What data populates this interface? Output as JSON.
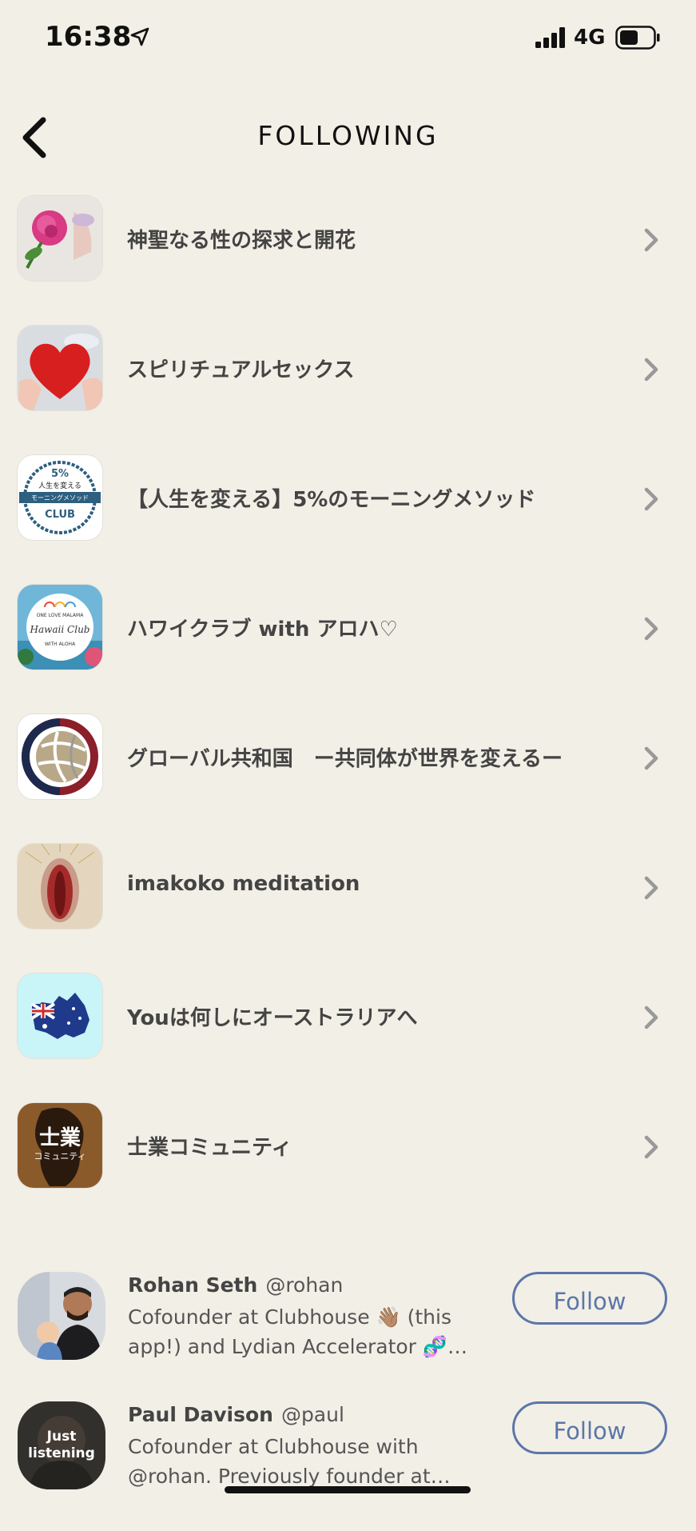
{
  "status_bar": {
    "time": "16:38",
    "network": "4G"
  },
  "header": {
    "title": "FOLLOWING"
  },
  "clubs": [
    {
      "name": "神聖なる性の探求と開花",
      "icon": "rose-image"
    },
    {
      "name": "スピリチュアルセックス",
      "icon": "heart-image"
    },
    {
      "name": "【人生を変える】5%のモーニングメソッド",
      "icon": "club-badge-image",
      "badge_top": "5%",
      "badge_mid": "人生を変える",
      "badge_band": "モーニングメソッド",
      "badge_bottom": "CLUB"
    },
    {
      "name": "ハワイクラブ with アロハ♡",
      "icon": "hawaii-club-image",
      "badge_top": "ONE LOVE MALAMA",
      "badge_mid": "Hawaii Club",
      "badge_bottom": "WITH ALOHA"
    },
    {
      "name": "グローバル共和国　ー共同体が世界を変えるー",
      "icon": "globe-logo"
    },
    {
      "name": "imakoko meditation",
      "icon": "meditation-image"
    },
    {
      "name": "Youは何しにオーストラリアへ",
      "icon": "australia-flag-map"
    },
    {
      "name": "士業コミュニティ",
      "icon": "shigyo-logo",
      "badge_mid": "士業",
      "badge_bottom": "コミュニティ"
    }
  ],
  "users": [
    {
      "name": "Rohan Seth",
      "handle": "@rohan",
      "bio": "Cofounder at Clubhouse 👋🏽 (this app!) and Lydian Accelerator 🧬 (n...",
      "follow_label": "Follow"
    },
    {
      "name": "Paul Davison",
      "handle": "@paul",
      "bio": "Cofounder at Clubhouse with @rohan. Previously founder at High...",
      "follow_label": "Follow",
      "avatar_caption": "Just listening"
    }
  ],
  "colors": {
    "background": "#f2efe6",
    "accent": "#5c76a9",
    "text": "#444444"
  }
}
